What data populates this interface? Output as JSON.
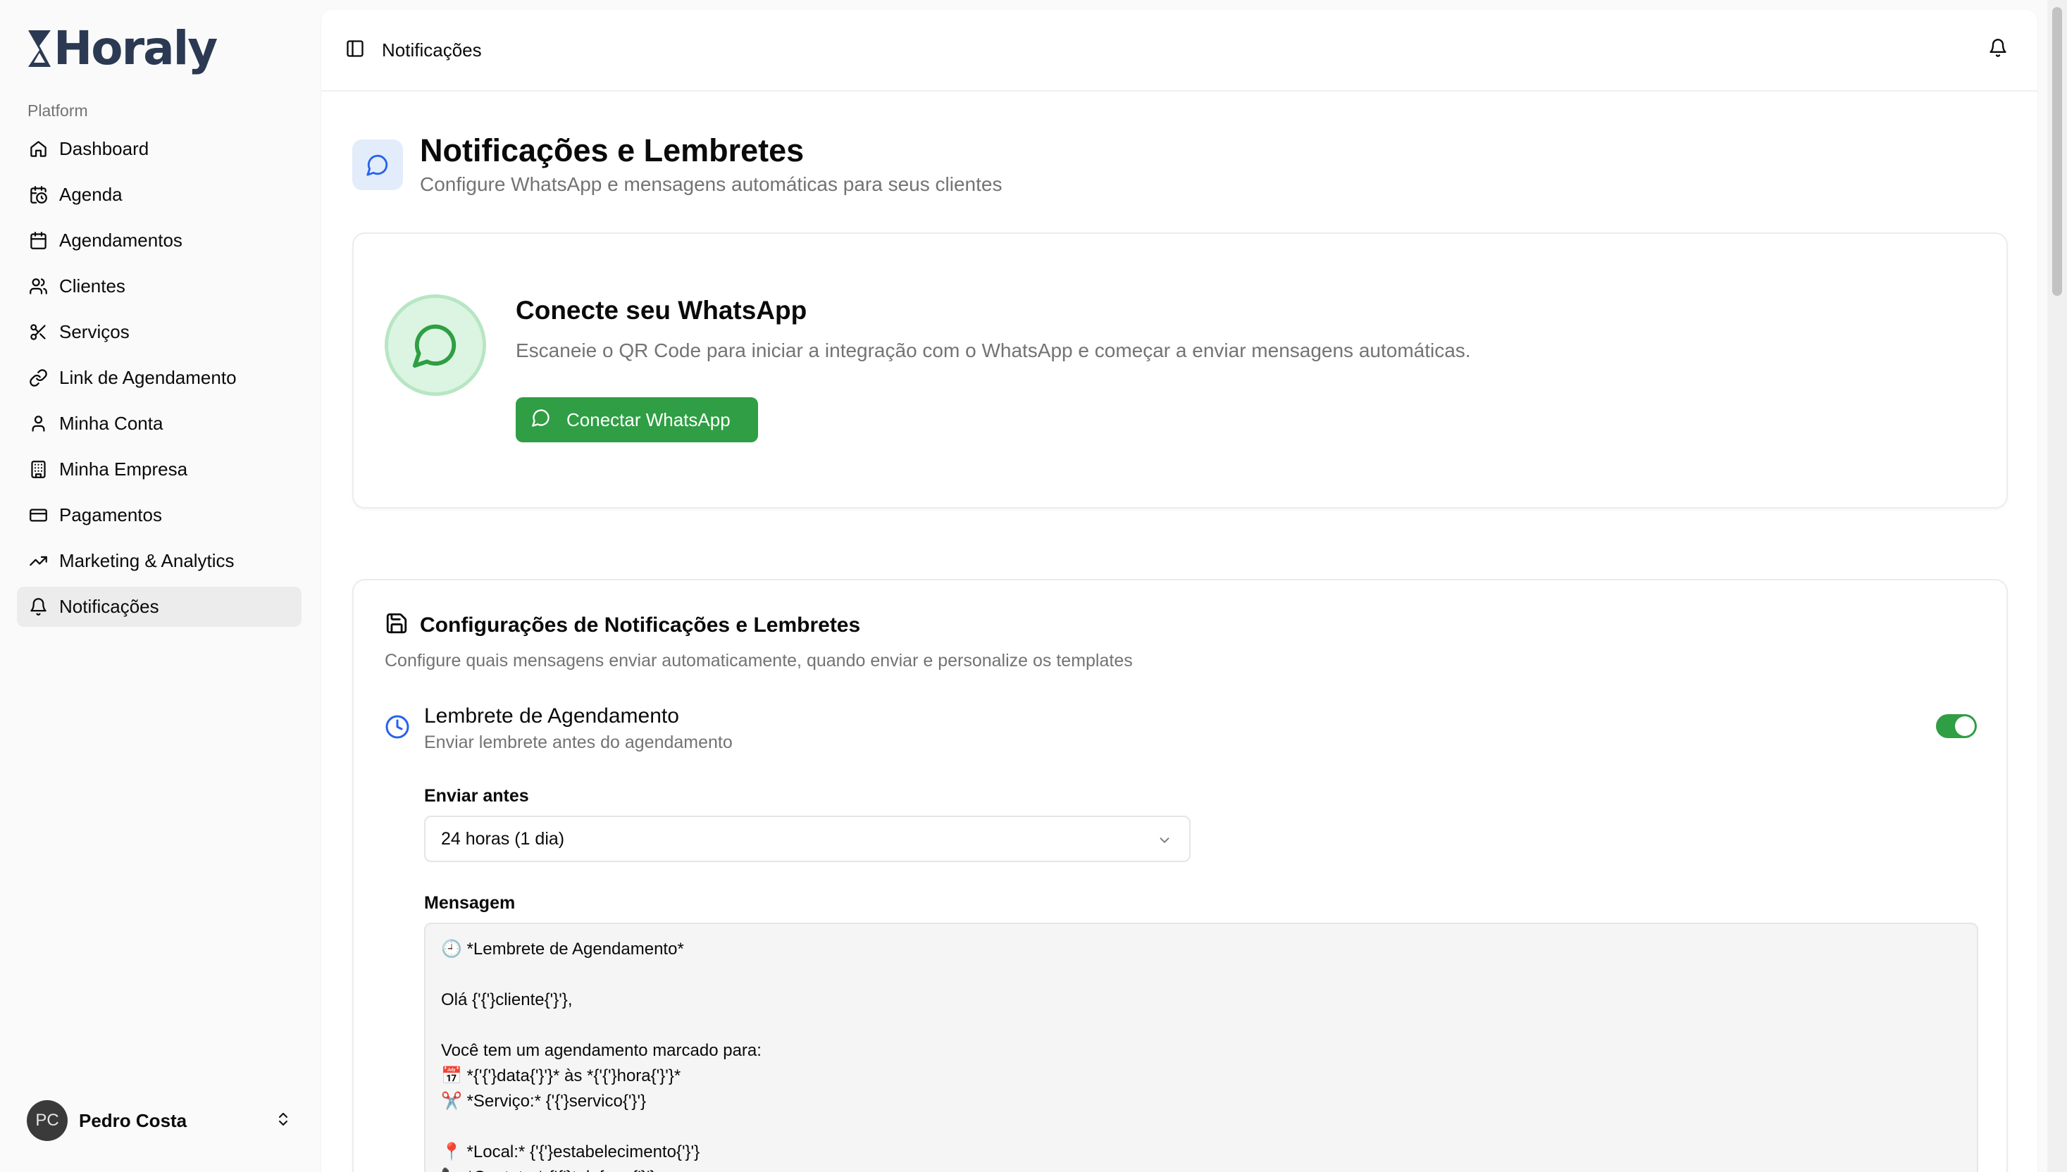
{
  "brand": {
    "name": "Horaly",
    "accent": "#2b3a52"
  },
  "sidebar": {
    "group_label": "Platform",
    "items": [
      {
        "label": "Dashboard",
        "icon": "home-icon"
      },
      {
        "label": "Agenda",
        "icon": "calendar-clock-icon"
      },
      {
        "label": "Agendamentos",
        "icon": "calendar-icon"
      },
      {
        "label": "Clientes",
        "icon": "users-icon"
      },
      {
        "label": "Serviços",
        "icon": "scissors-icon"
      },
      {
        "label": "Link de Agendamento",
        "icon": "link-icon"
      },
      {
        "label": "Minha Conta",
        "icon": "user-icon"
      },
      {
        "label": "Minha Empresa",
        "icon": "building-icon"
      },
      {
        "label": "Pagamentos",
        "icon": "credit-card-icon"
      },
      {
        "label": "Marketing & Analytics",
        "icon": "trending-up-icon"
      },
      {
        "label": "Notificações",
        "icon": "bell-icon",
        "active": true
      }
    ],
    "user": {
      "initials": "PC",
      "name": "Pedro Costa"
    }
  },
  "topbar": {
    "title": "Notificações"
  },
  "page": {
    "title": "Notificações e Lembretes",
    "subtitle": "Configure WhatsApp e mensagens automáticas para seus clientes"
  },
  "whatsapp": {
    "title": "Conecte seu WhatsApp",
    "subtitle": "Escaneie o QR Code para iniciar a integração com o WhatsApp e começar a enviar mensagens automáticas.",
    "button_label": "Conectar WhatsApp",
    "color": "#2f9e44"
  },
  "config": {
    "title": "Configurações de Notificações e Lembretes",
    "subtitle": "Configure quais mensagens enviar automaticamente, quando enviar e personalize os templates",
    "reminder": {
      "title": "Lembrete de Agendamento",
      "subtitle": "Enviar lembrete antes do agendamento",
      "enabled": true,
      "send_before_label": "Enviar antes",
      "send_before_value": "24 horas (1 dia)",
      "message_label": "Mensagem",
      "message_lines": [
        "🕘 *Lembrete de Agendamento*",
        "",
        "Olá {'{'}cliente{'}'},",
        "",
        "Você tem um agendamento marcado para:",
        "📅 *{'{'}data{'}'}* às *{'{'}hora{'}'}*",
        "✂️ *Serviço:* {'{'}servico{'}'}",
        "",
        "📍 *Local:* {'{'}estabelecimento{'}'}",
        "📞 *Contato:* {'{'}telefone{'}'}"
      ]
    }
  }
}
